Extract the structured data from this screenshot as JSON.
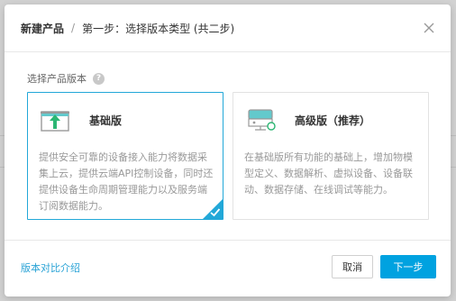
{
  "modal": {
    "title": "新建产品",
    "separator": "/",
    "step_text": "第一步：选择版本类型 (共二步)"
  },
  "section": {
    "label": "选择产品版本",
    "help": "?"
  },
  "cards": [
    {
      "title": "基础版",
      "description": "提供安全可靠的设备接入能力将数据采集上云，提供云端API控制设备，同时还提供设备生命周期管理能力以及服务端订阅数据能力。",
      "selected": true,
      "icon": "upload-icon"
    },
    {
      "title": "高级版（推荐）",
      "description": "在基础版所有功能的基础上，增加物模型定义、数据解析、虚拟设备、设备联动、数据存储、在线调试等能力。",
      "selected": false,
      "icon": "device-icon"
    }
  ],
  "footer": {
    "compare_link": "版本对比介绍",
    "cancel_label": "取消",
    "next_label": "下一步"
  },
  "colors": {
    "accent": "#00a2e0",
    "link": "#2aa3d6",
    "selected_border": "#22a8d8",
    "icon_green": "#2bb673",
    "icon_teal": "#63c9cc"
  }
}
